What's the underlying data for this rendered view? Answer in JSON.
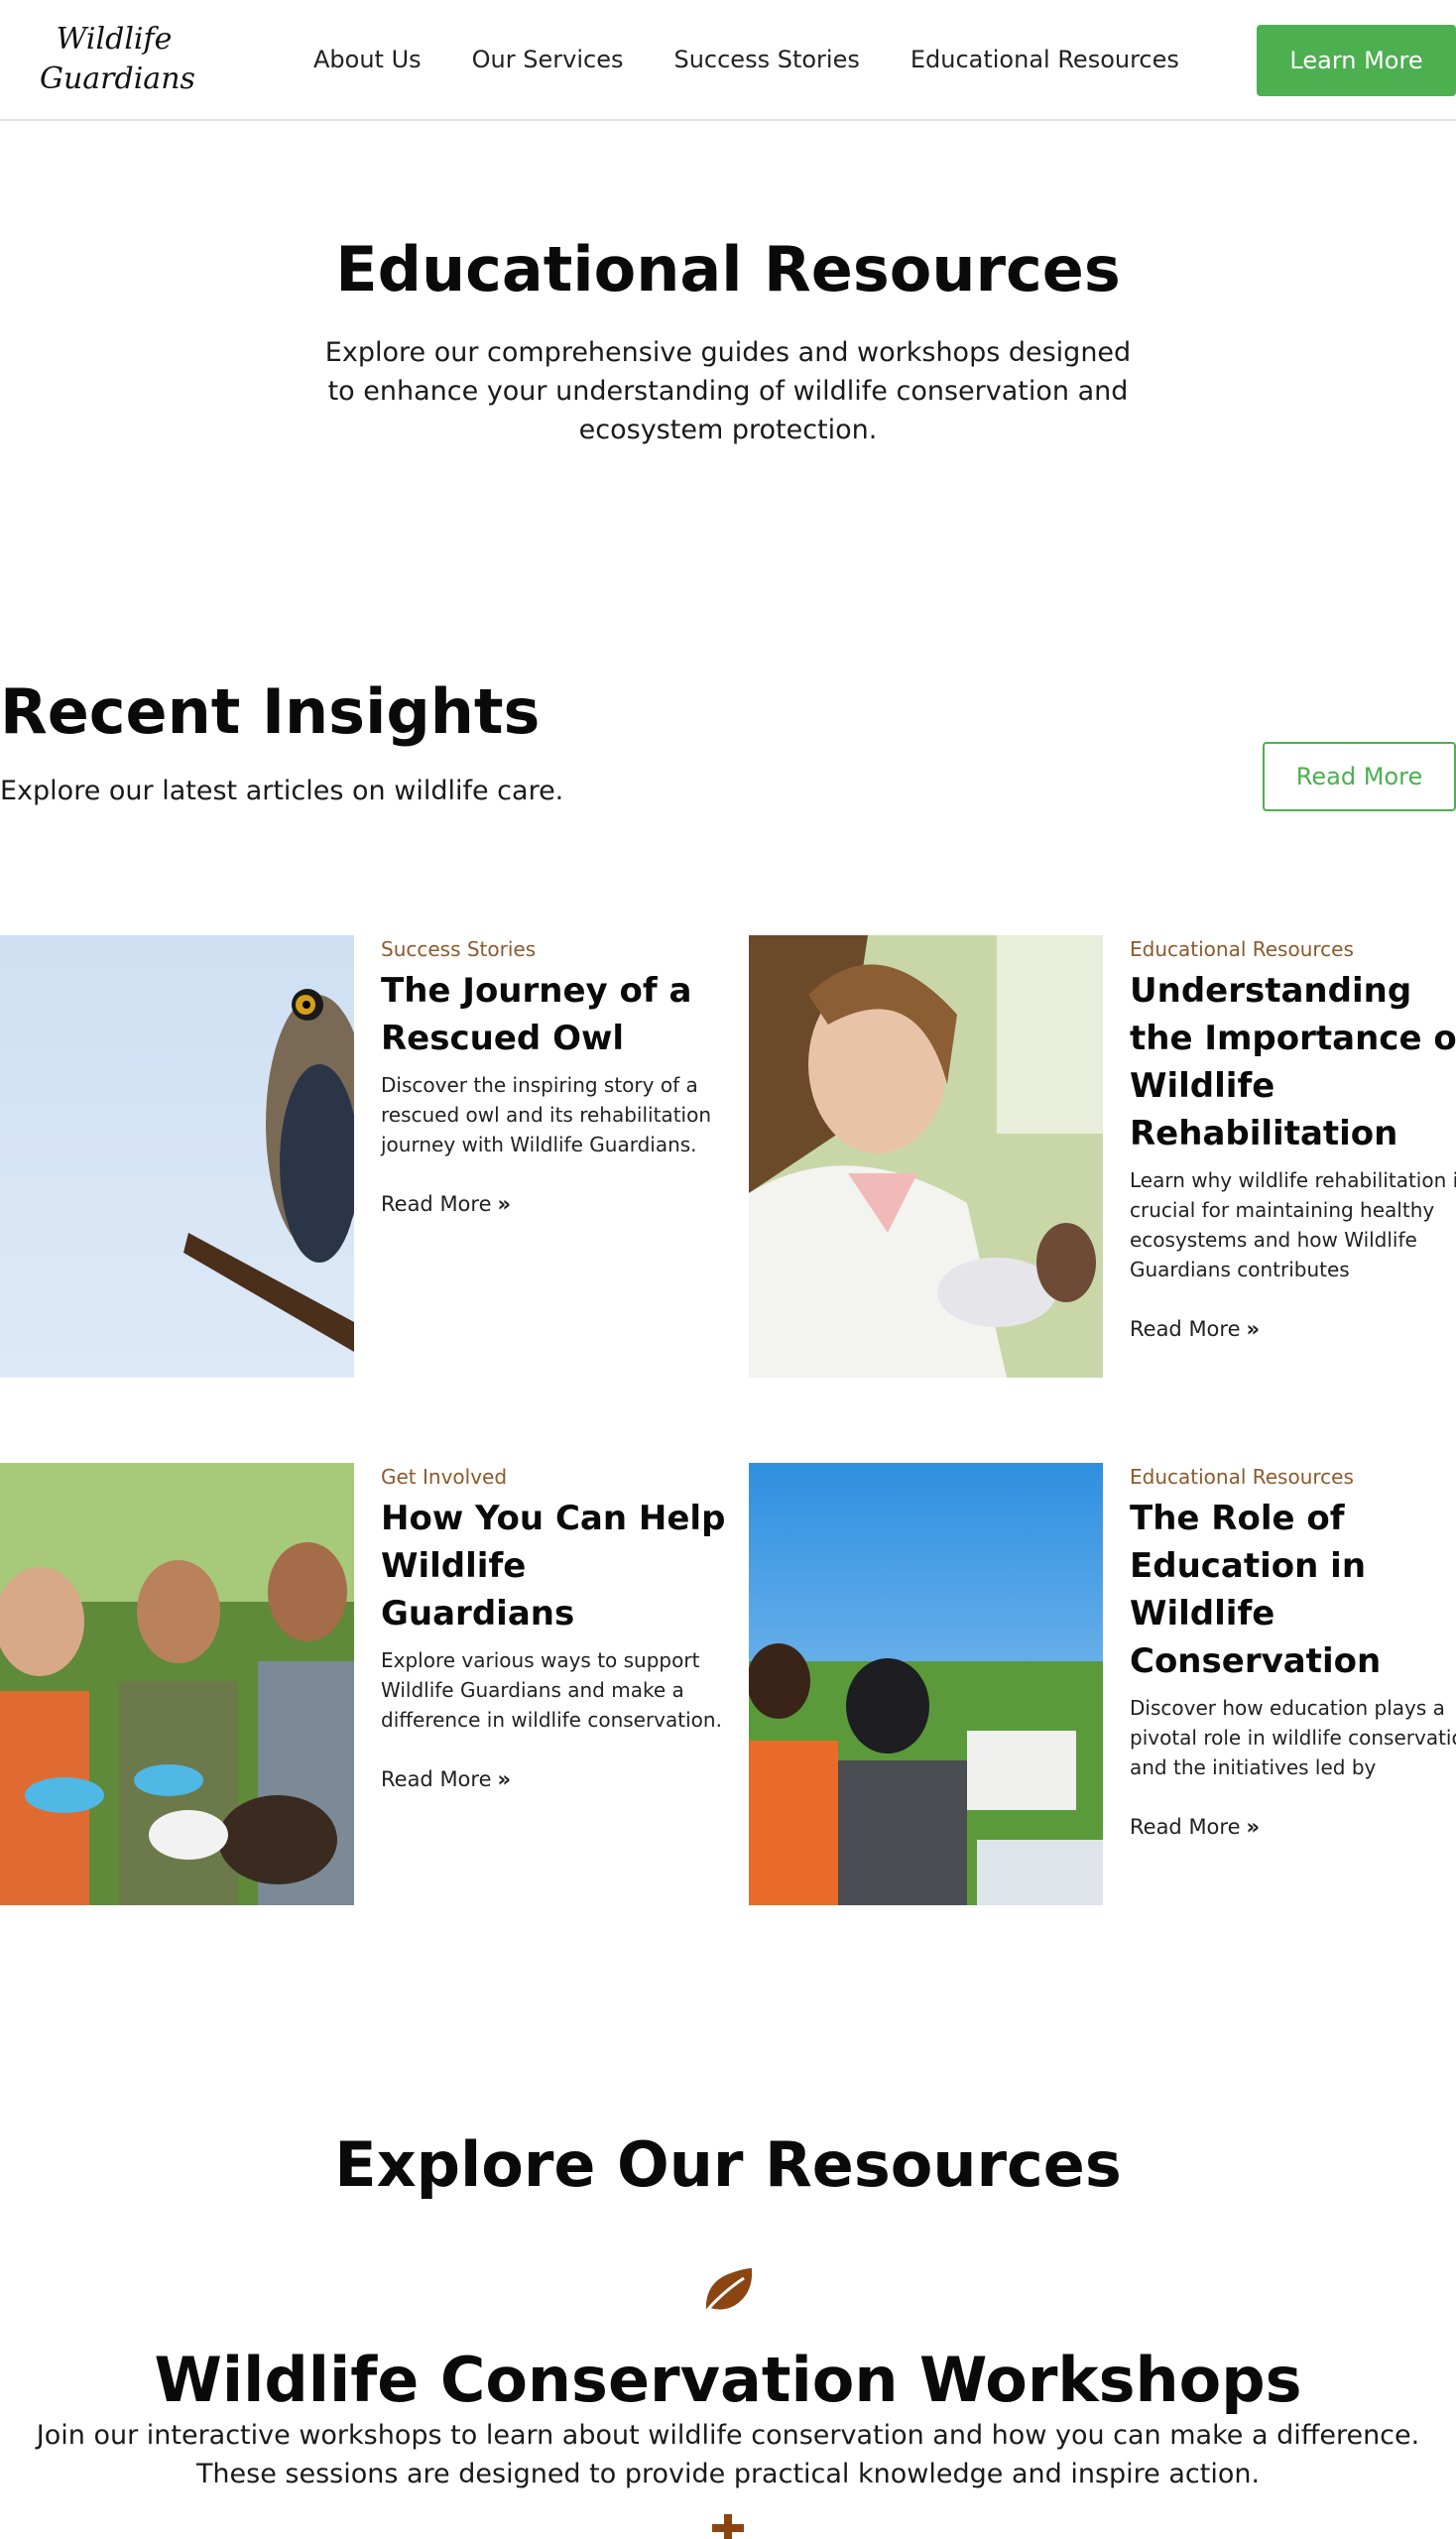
{
  "header": {
    "logo_line1": "Wildlife",
    "logo_line2": "Guardians",
    "nav": [
      "About Us",
      "Our Services",
      "Success Stories",
      "Educational Resources"
    ],
    "cta_label": "Learn More"
  },
  "hero": {
    "title": "Educational Resources",
    "subtitle": "Explore our comprehensive guides and workshops designed to enhance your understanding of wildlife conservation and ecosystem protection."
  },
  "insights": {
    "title": "Recent Insights",
    "subtitle": "Explore our latest articles on wildlife care.",
    "read_more_label": "Read More",
    "cards": [
      {
        "category": "Success Stories",
        "title": "The Journey of a Rescued Owl",
        "description": "Discover the inspiring story of a rescued owl and its rehabilitation journey with Wildlife Guardians.",
        "link": "Read More",
        "image": "owl-on-branch"
      },
      {
        "category": "Educational Resources",
        "title": "Understanding the Importance of Wildlife Rehabilitation",
        "description": "Learn why wildlife rehabilitation is crucial for maintaining healthy ecosystems and how Wildlife Guardians contributes",
        "link": "Read More",
        "image": "vet-with-animal"
      },
      {
        "category": "Get Involved",
        "title": "How You Can Help Wildlife Guardians",
        "description": "Explore various ways to support Wildlife Guardians and make a difference in wildlife conservation.",
        "link": "Read More",
        "image": "volunteers-with-animal"
      },
      {
        "category": "Educational Resources",
        "title": "The Role of Education in Wildlife Conservation",
        "description": "Discover how education plays a pivotal role in wildlife conservation and the initiatives led by",
        "link": "Read More",
        "image": "children-learning-outdoors"
      }
    ]
  },
  "explore": {
    "title": "Explore Our Resources",
    "icon": "leaf-icon",
    "workshop_title": "Wildlife Conservation Workshops",
    "workshop_desc": "Join our interactive workshops to learn about wildlife conservation and how you can make a difference. These sessions are designed to provide practical knowledge and inspire action."
  },
  "colors": {
    "accent_green": "#4caf50",
    "category_brown": "#8b5a2b"
  }
}
